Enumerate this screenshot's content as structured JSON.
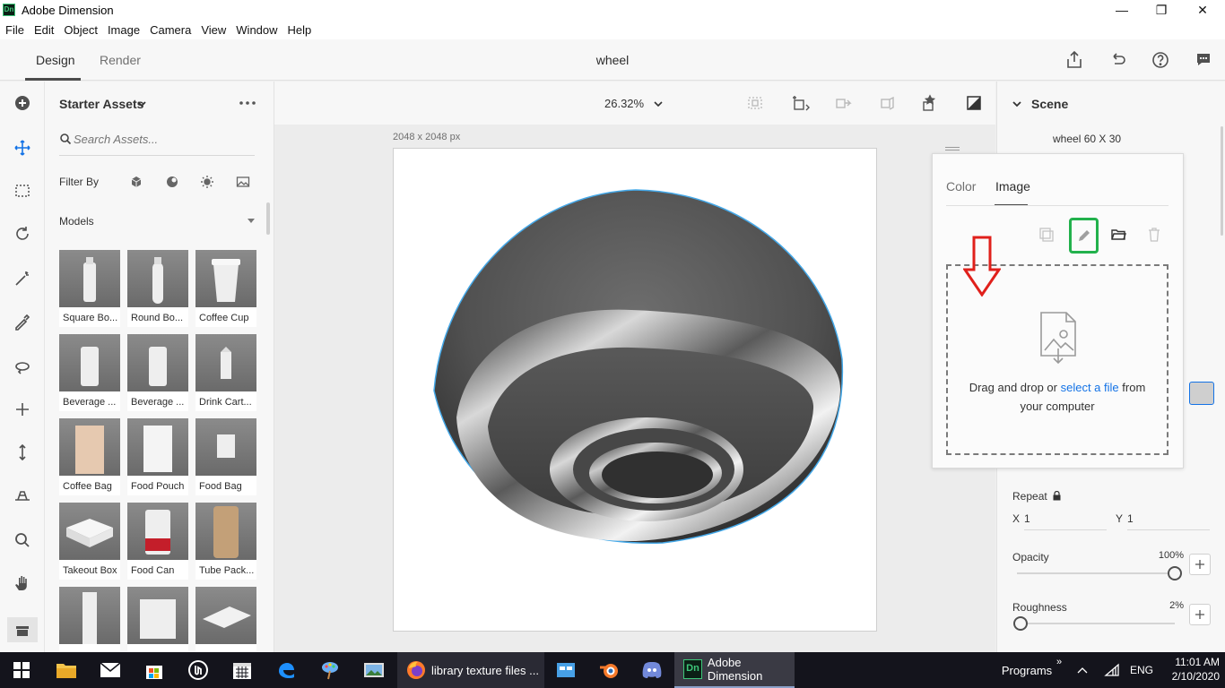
{
  "window": {
    "title": "Adobe Dimension",
    "app_icon_text": "Dn",
    "minimize": "—",
    "maximize": "❐",
    "close": "✕"
  },
  "menu": [
    "File",
    "Edit",
    "Object",
    "Image",
    "Camera",
    "View",
    "Window",
    "Help"
  ],
  "header": {
    "tabs": [
      "Design",
      "Render"
    ],
    "active_tab": "Design",
    "document_title": "wheel"
  },
  "assets": {
    "title": "Starter Assets",
    "search_placeholder": "Search Assets...",
    "filter_label": "Filter By",
    "section": "Models",
    "items": [
      "Square Bo...",
      "Round Bo...",
      "Coffee Cup",
      "Beverage ...",
      "Beverage ...",
      "Drink Cart...",
      "Coffee Bag",
      "Food Pouch",
      "Food Bag",
      "Takeout Box",
      "Food Can",
      "Tube Pack...",
      "",
      "",
      ""
    ]
  },
  "canvas": {
    "zoom": "26.32%",
    "size_label": "2048 x 2048 px"
  },
  "scene": {
    "title": "Scene",
    "object_name": "wheel 60 X 30"
  },
  "popover": {
    "tabs": [
      "Color",
      "Image"
    ],
    "active_tab": "Image",
    "drop_text_1": "Drag and drop or ",
    "drop_link": "select a file",
    "drop_text_2": " from",
    "drop_text_3": "your computer"
  },
  "properties": {
    "repeat_label": "Repeat",
    "x_label": "X",
    "x_value": "1",
    "y_label": "Y",
    "y_value": "1",
    "opacity_label": "Opacity",
    "opacity_value": "100%",
    "opacity_level": 1.0,
    "roughness_label": "Roughness",
    "roughness_value": "2%",
    "roughness_level": 0.02
  },
  "taskbar": {
    "firefox_label": "library texture files ...",
    "dimension_label": "Adobe Dimension",
    "dimension_icon_text": "Dn",
    "programs": "Programs",
    "programs_chevron": "»",
    "language": "ENG",
    "time": "11:01 AM",
    "date": "2/10/2020"
  },
  "colors": {
    "accent_link": "#1473e6",
    "highlight_green": "#22b14c",
    "arrow_red": "#e0201b",
    "selection_blue": "#3aa0e8"
  }
}
